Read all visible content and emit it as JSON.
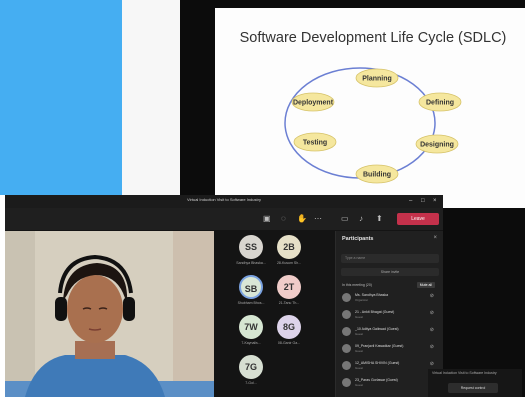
{
  "slide": {
    "title": "Software Development Life Cycle (SDLC)",
    "phases": [
      "Planning",
      "Defining",
      "Designing",
      "Building",
      "Testing",
      "Deployment"
    ]
  },
  "meeting": {
    "window_title": "Virtual Induction Visit to Software Industry",
    "controls": {
      "leave": "Leave"
    },
    "tiles": [
      {
        "initials": "SS",
        "name": "Sandhya Bhaska..."
      },
      {
        "initials": "2B",
        "name": "28-Kusum Sh..."
      },
      {
        "initials": "SB",
        "name": "Shubham Bhos..."
      },
      {
        "initials": "2T",
        "name": "21-Tanu Th..."
      },
      {
        "initials": "7W",
        "name": "7-Kaynalis..."
      },
      {
        "initials": "8G",
        "name": "08-Ganir Ga..."
      },
      {
        "initials": "7G",
        "name": "7-Gol..."
      }
    ],
    "participants_panel": {
      "title": "Participants",
      "search_placeholder": "Type a name",
      "share_invite": "Share invite",
      "section": "In this meeting (20)",
      "mute_all": "Mute all",
      "people": [
        {
          "name": "Ms. Sandhya Bhaska",
          "role": "Organizer"
        },
        {
          "name": "21 - Ankit Bhagat (Guest)",
          "role": "Guest"
        },
        {
          "name": "_10 Aditya Gaikwad (Guest)",
          "role": "Guest"
        },
        {
          "name": "09_Pranjavli Kawadkar (Guest)",
          "role": "Guest"
        },
        {
          "name": "12_AMISHA SHIVIN (Guest)",
          "role": "Guest"
        },
        {
          "name": "23_Paras Gorlawar (Guest)",
          "role": "Guest"
        }
      ]
    }
  },
  "mini_window": {
    "title": "Virtual Induction Visit to Software Industry",
    "button": "Request control"
  },
  "colors": {
    "accent_blue": "#45aef2",
    "phase_fill": "#f5e79e",
    "cycle_line": "#6b7fd3",
    "leave_red": "#c4314b"
  }
}
